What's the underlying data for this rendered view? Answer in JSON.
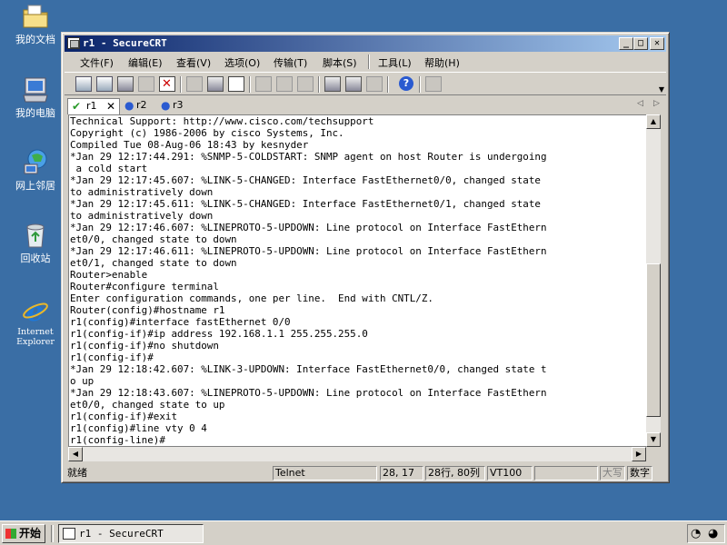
{
  "desktop": {
    "icons": [
      {
        "label": "我的文档",
        "icon": "my-documents-icon"
      },
      {
        "label": "我的电脑",
        "icon": "my-computer-icon"
      },
      {
        "label": "网上邻居",
        "icon": "network-places-icon"
      },
      {
        "label": "回收站",
        "icon": "recycle-bin-icon"
      },
      {
        "label": "Internet Explorer",
        "icon": "internet-explorer-icon"
      }
    ]
  },
  "window": {
    "title": "r1 - SecureCRT",
    "controls": {
      "minimize": "_",
      "maximize": "□",
      "close": "✕"
    },
    "menu": [
      "文件(F)",
      "编辑(E)",
      "查看(V)",
      "选项(O)",
      "传输(T)",
      "脚本(S)",
      "工具(L)",
      "帮助(H)"
    ],
    "tabs": [
      {
        "label": "r1",
        "status": "✔",
        "active": true
      },
      {
        "label": "r2",
        "status": "●"
      },
      {
        "label": "r3",
        "status": "●"
      }
    ],
    "terminal_lines": [
      "Technical Support: http://www.cisco.com/techsupport",
      "Copyright (c) 1986-2006 by cisco Systems, Inc.",
      "Compiled Tue 08-Aug-06 18:43 by kesnyder",
      "*Jan 29 12:17:44.291: %SNMP-5-COLDSTART: SNMP agent on host Router is undergoing",
      " a cold start",
      "*Jan 29 12:17:45.607: %LINK-5-CHANGED: Interface FastEthernet0/0, changed state",
      "to administratively down",
      "*Jan 29 12:17:45.611: %LINK-5-CHANGED: Interface FastEthernet0/1, changed state",
      "to administratively down",
      "*Jan 29 12:17:46.607: %LINEPROTO-5-UPDOWN: Line protocol on Interface FastEthern",
      "et0/0, changed state to down",
      "*Jan 29 12:17:46.611: %LINEPROTO-5-UPDOWN: Line protocol on Interface FastEthern",
      "et0/1, changed state to down",
      "Router>enable",
      "Router#configure terminal",
      "Enter configuration commands, one per line.  End with CNTL/Z.",
      "Router(config)#hostname r1",
      "r1(config)#interface fastEthernet 0/0",
      "r1(config-if)#ip address 192.168.1.1 255.255.255.0",
      "r1(config-if)#no shutdown",
      "r1(config-if)#",
      "*Jan 29 12:18:42.607: %LINK-3-UPDOWN: Interface FastEthernet0/0, changed state t",
      "o up",
      "*Jan 29 12:18:43.607: %LINEPROTO-5-UPDOWN: Line protocol on Interface FastEthern",
      "et0/0, changed state to up",
      "r1(config-if)#exit",
      "r1(config)#line vty 0 4",
      "r1(config-line)#"
    ],
    "status": {
      "ready": "就绪",
      "protocol": "Telnet",
      "cursor": "28, 17",
      "size": "28行, 80列",
      "emulation": "VT100",
      "blank": "",
      "caps": "大写",
      "num": "数字"
    }
  },
  "taskbar": {
    "start_label": "开始",
    "task_title": "r1 - SecureCRT"
  }
}
